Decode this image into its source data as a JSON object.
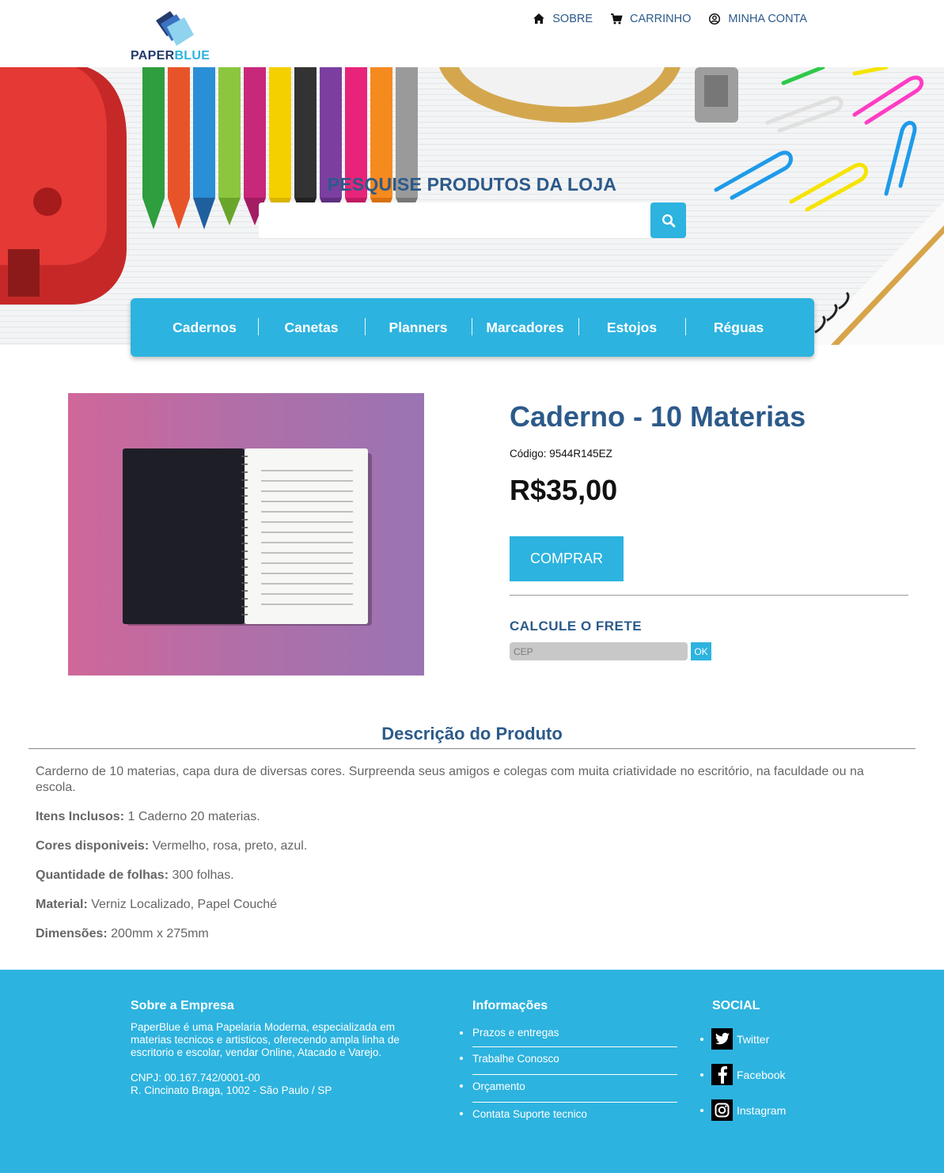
{
  "brand": {
    "name_part1": "PAPER",
    "name_part2": "BLUE"
  },
  "topnav": {
    "about": "SOBRE",
    "cart": "CARRINHO",
    "account": "MINHA CONTA"
  },
  "search": {
    "title": "PESQUISE PRODUTOS DA LOJA",
    "value": "",
    "placeholder": ""
  },
  "categories": [
    "Cadernos",
    "Canetas",
    "Planners",
    "Marcadores",
    "Estojos",
    "Réguas"
  ],
  "product": {
    "title": "Caderno - 10 Materias",
    "code": "Código: 9544R145EZ",
    "price": "R$35,00",
    "buy_label": "COMPRAR"
  },
  "shipping": {
    "title": "CALCULE O FRETE",
    "placeholder": "CEP",
    "ok_label": "OK"
  },
  "description": {
    "title": "Descrição do Produto",
    "intro": "Carderno de 10 materias, capa dura de diversas cores. Surpreenda seus amigos e colegas com muita criatividade no escritório, na faculdade ou na escola.",
    "specs": [
      {
        "label": "Itens Inclusos:",
        "value": " 1 Caderno 20 materias."
      },
      {
        "label": "Cores disponiveis:",
        "value": " Vermelho, rosa, preto, azul."
      },
      {
        "label": "Quantidade de folhas:",
        "value": " 300 folhas."
      },
      {
        "label": "Material:",
        "value": " Verniz Localizado, Papel Couché"
      },
      {
        "label": "Dimensões:",
        "value": " 200mm x 275mm"
      }
    ]
  },
  "footer": {
    "about": {
      "title": "Sobre a Empresa",
      "text": "PaperBlue é uma Papelaria Moderna, especializada em materias tecnicos e artisticos, oferecendo ampla linha de escritorio e escolar, vendar Online, Atacado e Varejo.",
      "cnpj": "CNPJ: 00.167.742/0001-00",
      "address": "R. Cincinato Braga, 1002 - São Paulo / SP"
    },
    "info": {
      "title": "Informações",
      "items": [
        "Prazos e entregas",
        "Trabalhe Conosco",
        "Orçamento",
        "Contata Suporte tecnico"
      ]
    },
    "social": {
      "title": "SOCIAL",
      "items": [
        "Twitter",
        "Facebook",
        "Instagram"
      ]
    }
  },
  "colors": {
    "accent": "#2db3df",
    "heading": "#2c5a8a",
    "brand_dark": "#243b6b"
  },
  "icons": [
    "home-icon",
    "cart-icon",
    "user-circle-icon",
    "search-icon",
    "twitter-icon",
    "facebook-icon",
    "instagram-icon"
  ]
}
